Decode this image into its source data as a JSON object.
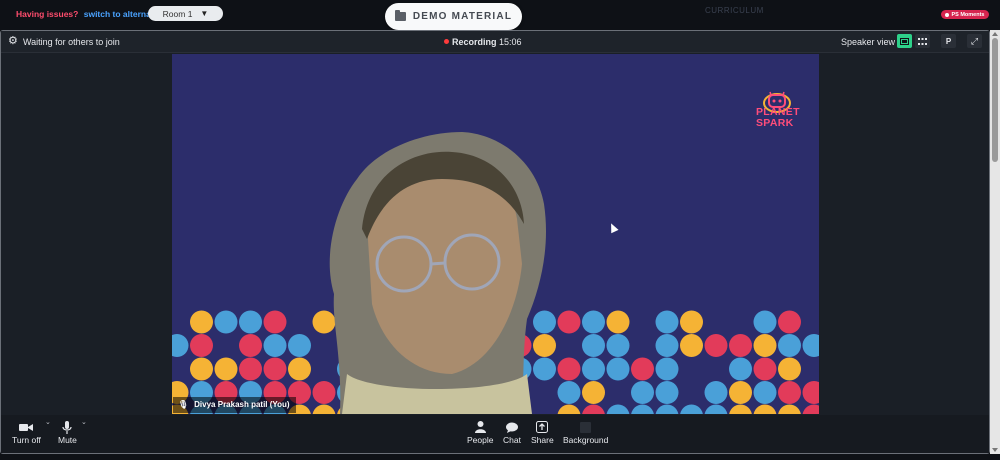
{
  "top": {
    "issues_label": "Having issues?",
    "switch_link": "switch to alternate room",
    "room_select_value": "Room 1",
    "demo_button": "DEMO MATERIAL",
    "curriculum_label": "CURRICULUM",
    "ps_moments": "PS Moments"
  },
  "meeting": {
    "waiting_text": "Waiting for others to join",
    "recording_label": "Recording",
    "recording_time": "15:06",
    "speaker_view": "Speaker view",
    "participant_initial": "P"
  },
  "video": {
    "participant_name": "Divya Prakash patil (You)",
    "logo_line1": "PLANET",
    "logo_line2": "SPARK"
  },
  "controls": {
    "turn_off": "Turn off",
    "mute": "Mute",
    "people": "People",
    "chat": "Chat",
    "share": "Share",
    "background": "Background"
  },
  "colors": {
    "accent_green": "#2ed18a",
    "video_bg": "#2c2d6b",
    "recording_red": "#ff3b3b",
    "dot_yellow": "#f5b335",
    "dot_blue": "#4aa0d8",
    "dot_pink": "#e23b5a"
  }
}
